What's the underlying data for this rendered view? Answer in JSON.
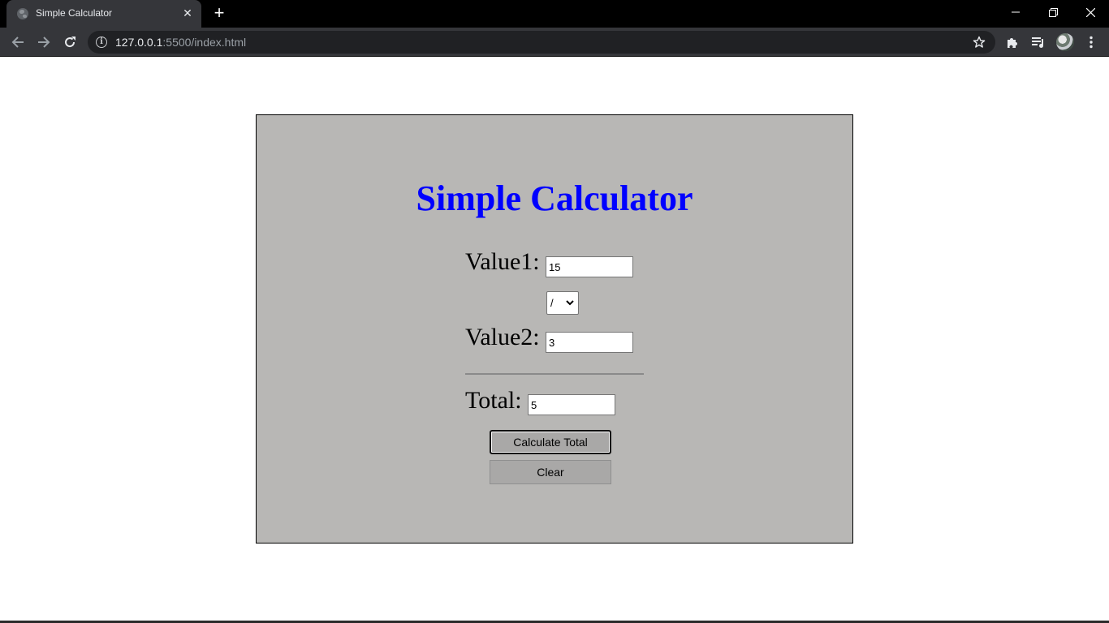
{
  "browser": {
    "tab_title": "Simple Calculator",
    "url_host": "127.0.0.1",
    "url_path": ":5500/index.html"
  },
  "calculator": {
    "title": "Simple Calculator",
    "value1_label": "Value1:",
    "value1": "15",
    "operator": "/",
    "operator_options": [
      "+",
      "-",
      "*",
      "/"
    ],
    "value2_label": "Value2:",
    "value2": "3",
    "total_label": "Total:",
    "total": "5",
    "calculate_label": "Calculate Total",
    "clear_label": "Clear"
  },
  "colors": {
    "title_blue": "#0000ff",
    "panel_bg": "#b8b7b5",
    "button_bg": "#a9a8a7"
  }
}
